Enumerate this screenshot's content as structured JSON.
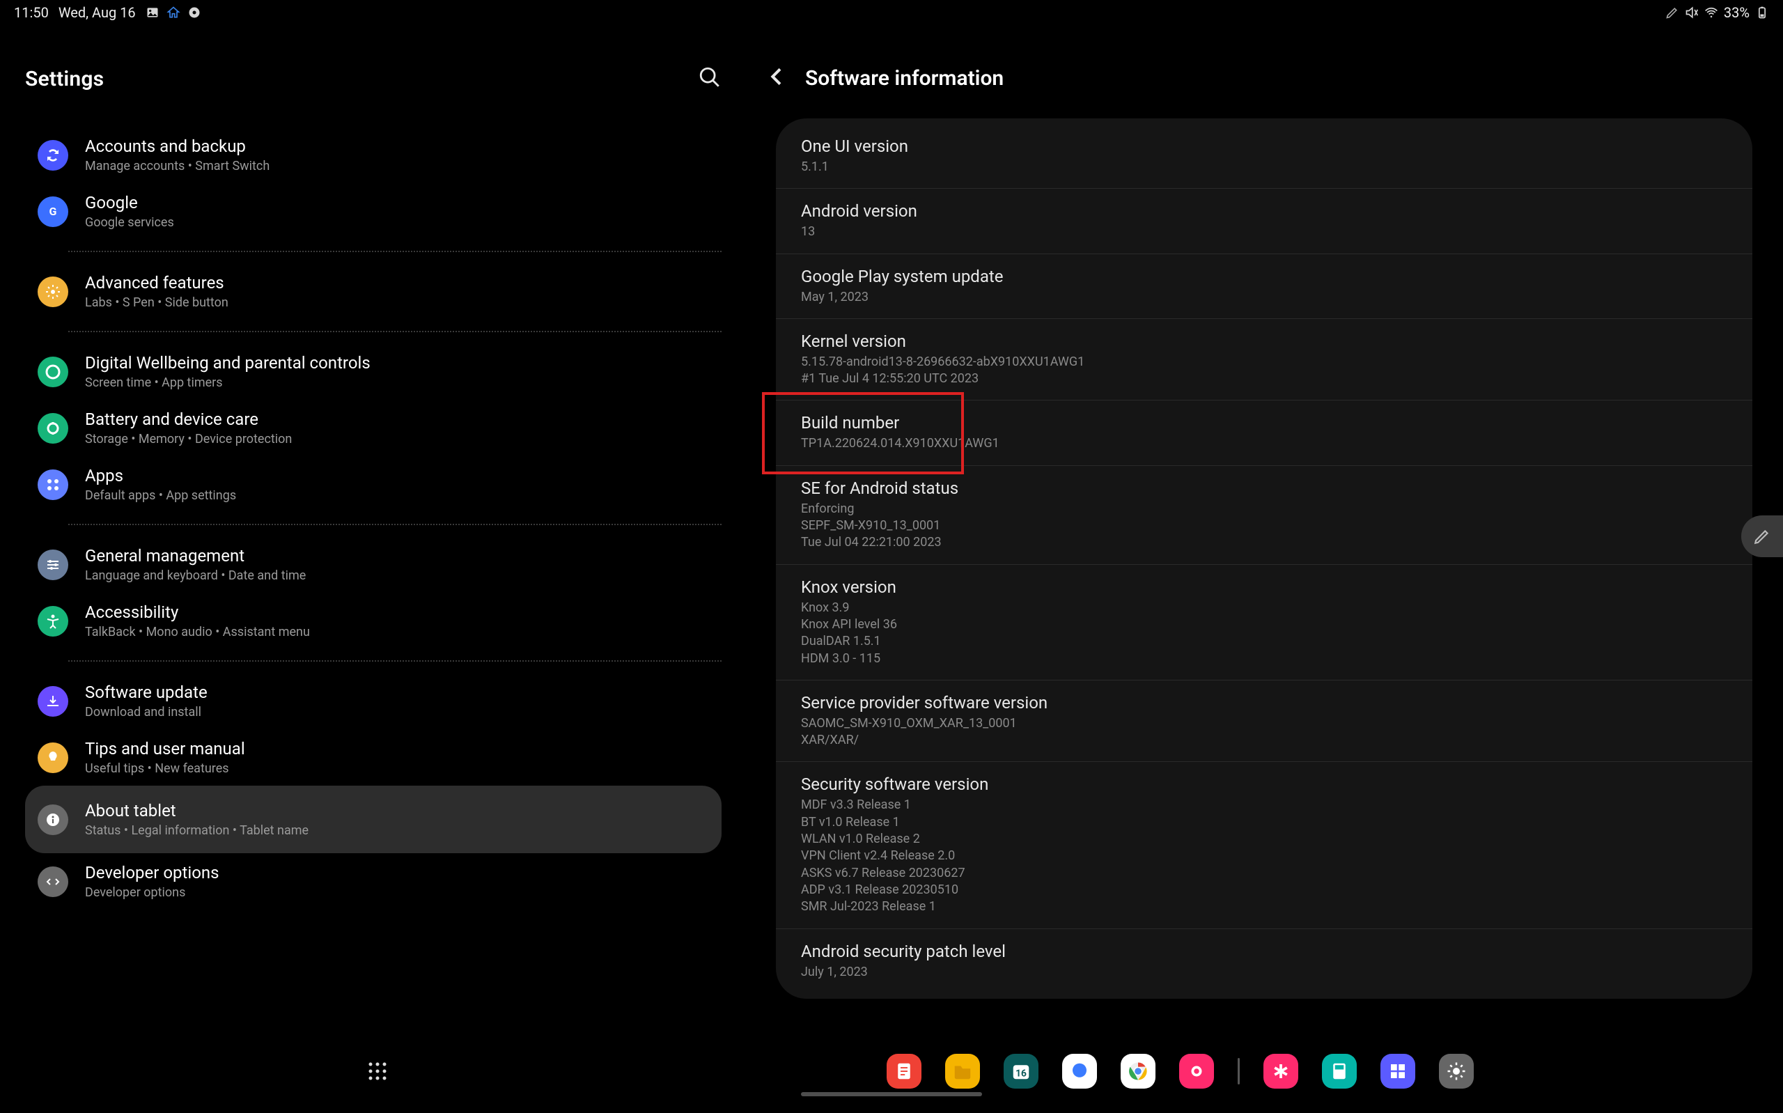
{
  "statusbar": {
    "time": "11:50",
    "date": "Wed, Aug 16",
    "battery": "33%"
  },
  "left": {
    "title": "Settings",
    "items": [
      {
        "title": "Accounts and backup",
        "sub": "Manage accounts  •  Smart Switch",
        "iconBg": "#4a57ff",
        "icon": "sync"
      },
      {
        "title": "Google",
        "sub": "Google services",
        "iconBg": "#3b6fff",
        "icon": "google"
      },
      {
        "divider": true
      },
      {
        "title": "Advanced features",
        "sub": "Labs  •  S Pen  •  Side button",
        "iconBg": "#f1b23b",
        "icon": "gear"
      },
      {
        "divider": true
      },
      {
        "title": "Digital Wellbeing and parental controls",
        "sub": "Screen time  •  App timers",
        "iconBg": "#17b57a",
        "icon": "wellbeing"
      },
      {
        "title": "Battery and device care",
        "sub": "Storage  •  Memory  •  Device protection",
        "iconBg": "#17b57a",
        "icon": "battery"
      },
      {
        "title": "Apps",
        "sub": "Default apps  •  App settings",
        "iconBg": "#617fff",
        "icon": "apps"
      },
      {
        "divider": true
      },
      {
        "title": "General management",
        "sub": "Language and keyboard  •  Date and time",
        "iconBg": "#6a7e9c",
        "icon": "sliders"
      },
      {
        "title": "Accessibility",
        "sub": "TalkBack  •  Mono audio  •  Assistant menu",
        "iconBg": "#17b57a",
        "icon": "accessibility"
      },
      {
        "divider": true
      },
      {
        "title": "Software update",
        "sub": "Download and install",
        "iconBg": "#6a4cff",
        "icon": "update"
      },
      {
        "title": "Tips and user manual",
        "sub": "Useful tips  •  New features",
        "iconBg": "#f1b23b",
        "icon": "bulb"
      },
      {
        "title": "About tablet",
        "sub": "Status  •  Legal information  •  Tablet name",
        "iconBg": "#6a6a6a",
        "icon": "info",
        "active": true
      },
      {
        "title": "Developer options",
        "sub": "Developer options",
        "iconBg": "#6a6a6a",
        "icon": "dev"
      }
    ]
  },
  "right": {
    "title": "Software information",
    "rows": [
      {
        "title": "One UI version",
        "sub": "5.1.1"
      },
      {
        "title": "Android version",
        "sub": "13"
      },
      {
        "title": "Google Play system update",
        "sub": "May 1, 2023"
      },
      {
        "title": "Kernel version",
        "sub": "5.15.78-android13-8-26966632-abX910XXU1AWG1\n#1 Tue Jul 4 12:55:20 UTC 2023"
      },
      {
        "title": "Build number",
        "sub": "TP1A.220624.014.X910XXU1AWG1",
        "highlight": true
      },
      {
        "title": "SE for Android status",
        "sub": "Enforcing\nSEPF_SM-X910_13_0001\nTue Jul 04 22:21:00 2023"
      },
      {
        "title": "Knox version",
        "sub": "Knox 3.9\nKnox API level 36\nDualDAR 1.5.1\nHDM 3.0 - 115"
      },
      {
        "title": "Service provider software version",
        "sub": "SAOMC_SM-X910_OXM_XAR_13_0001\nXAR/XAR/"
      },
      {
        "title": "Security software version",
        "sub": "MDF v3.3 Release 1\nBT v1.0 Release 1\nWLAN v1.0 Release 2\nVPN Client v2.4 Release 2.0\nASKS v6.7 Release 20230627\nADP v3.1 Release 20230510\nSMR Jul-2023 Release 1"
      },
      {
        "title": "Android security patch level",
        "sub": "July 1, 2023"
      }
    ]
  },
  "dock": {
    "apps": [
      {
        "name": "notes",
        "bg": "#ef4135"
      },
      {
        "name": "files",
        "bg": "#f5b400"
      },
      {
        "name": "calendar",
        "bg": "#0a5a5a"
      },
      {
        "name": "messages",
        "bg": "#fff"
      },
      {
        "name": "chrome",
        "bg": "#fff"
      },
      {
        "name": "camera",
        "bg": "#ff2a6d"
      }
    ],
    "recent": [
      {
        "name": "asterisk",
        "bg": "#ff2a6d"
      },
      {
        "name": "calc",
        "bg": "#04b5a8"
      },
      {
        "name": "grid",
        "bg": "#5b5bff"
      },
      {
        "name": "settings",
        "bg": "#666"
      }
    ]
  }
}
